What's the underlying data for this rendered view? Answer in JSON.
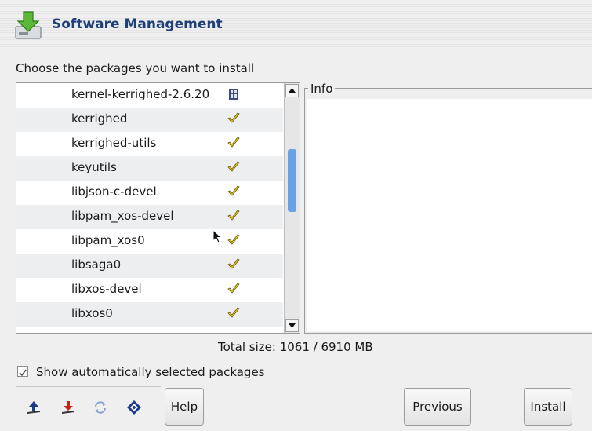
{
  "header": {
    "title": "Software Management",
    "icon": "software-install-icon"
  },
  "prompt": "Choose the packages you want to install",
  "packages": [
    {
      "name": "kernel-kerrighed-2.6.20",
      "status": "locked"
    },
    {
      "name": "kerrighed",
      "status": "selected"
    },
    {
      "name": "kerrighed-utils",
      "status": "selected"
    },
    {
      "name": "keyutils",
      "status": "selected"
    },
    {
      "name": "libjson-c-devel",
      "status": "selected"
    },
    {
      "name": "libpam_xos-devel",
      "status": "selected"
    },
    {
      "name": "libpam_xos0",
      "status": "selected"
    },
    {
      "name": "libsaga0",
      "status": "selected"
    },
    {
      "name": "libxos-devel",
      "status": "selected"
    },
    {
      "name": "libxos0",
      "status": "selected"
    }
  ],
  "info": {
    "legend": "Info"
  },
  "total_size": "Total size: 1061 / 6910 MB",
  "show_auto": {
    "label": "Show automatically selected packages",
    "checked": true
  },
  "toolbar": {
    "icons": [
      "install-up-icon",
      "remove-down-icon",
      "refresh-icon",
      "save-icon"
    ]
  },
  "buttons": {
    "help": "Help",
    "previous": "Previous",
    "install": "Install"
  },
  "colors": {
    "title": "#1f3f78",
    "scroll_thumb": "#6aa1e4",
    "check": "#e8c21a"
  }
}
